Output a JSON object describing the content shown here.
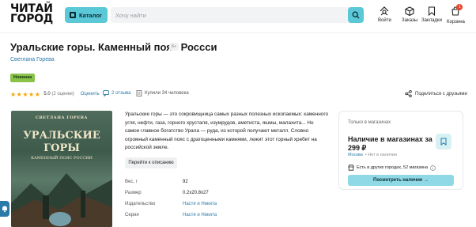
{
  "header": {
    "logo_line1": "ЧИТАЙ",
    "logo_line2": "ГОРОД",
    "catalog_label": "Каталог",
    "search_placeholder": "Хочу найти",
    "nav": [
      {
        "label": "Войти",
        "icon": "user-icon"
      },
      {
        "label": "Заказы",
        "icon": "box-icon"
      },
      {
        "label": "Закладки",
        "icon": "bookmark-icon"
      },
      {
        "label": "Корзина",
        "icon": "cart-icon",
        "badge": "1"
      }
    ]
  },
  "product": {
    "title": "Уральские горы. Каменный пояс Россси",
    "age": "6+",
    "author": "Светлана Горева",
    "badge": "Новинка",
    "rating_value": "5.0",
    "rating_count": "(2 оценки)",
    "rate_label": "Оценить",
    "reviews": "2 отзыва",
    "bought": "Купили 34 человека",
    "share": "Поделиться с друзьями",
    "cover_title_1": "УРАЛЬСКИЕ",
    "cover_title_2": "ГОРЫ",
    "cover_subtitle": "КАМЕННЫЙ ПОЯС РОССИИ",
    "cover_author": "СВЕТЛАНА ГОРЕВА",
    "description": "Уральские горы — это сокровищница самых разных полезных ископаемых: каменного угля, нефти, газа, горного хрусталя, изумрудов, аметиста, яшмы, малахита... Но самое главное богатство Урала — руда, из которой получают металл. Словно огромный каменный пояс с драгоценными камнями, лежит этот горный хребет на российской земле.",
    "more_label": "Перейти к описанию",
    "specs": [
      {
        "key": "Вес, г",
        "value": "92"
      },
      {
        "key": "Размер",
        "value": "0.2x20.8x27"
      },
      {
        "key": "Издательство",
        "value": "Настя и Никита"
      },
      {
        "key": "Серия",
        "value": "Настя и Никита"
      }
    ]
  },
  "store_card": {
    "label": "Только в магазинах",
    "availability": "Наличие в магазинах за 299 ₽",
    "city": "Москва",
    "city_status": "• Нет в наличии",
    "other_stores": "Есть в других городах, 52 магазина",
    "watch_label": "Посмотреть наличие"
  },
  "colors": {
    "accent": "#5bc8d8",
    "link": "#2a7aa8",
    "star": "#f6a700",
    "new_badge": "#8bc34a"
  }
}
